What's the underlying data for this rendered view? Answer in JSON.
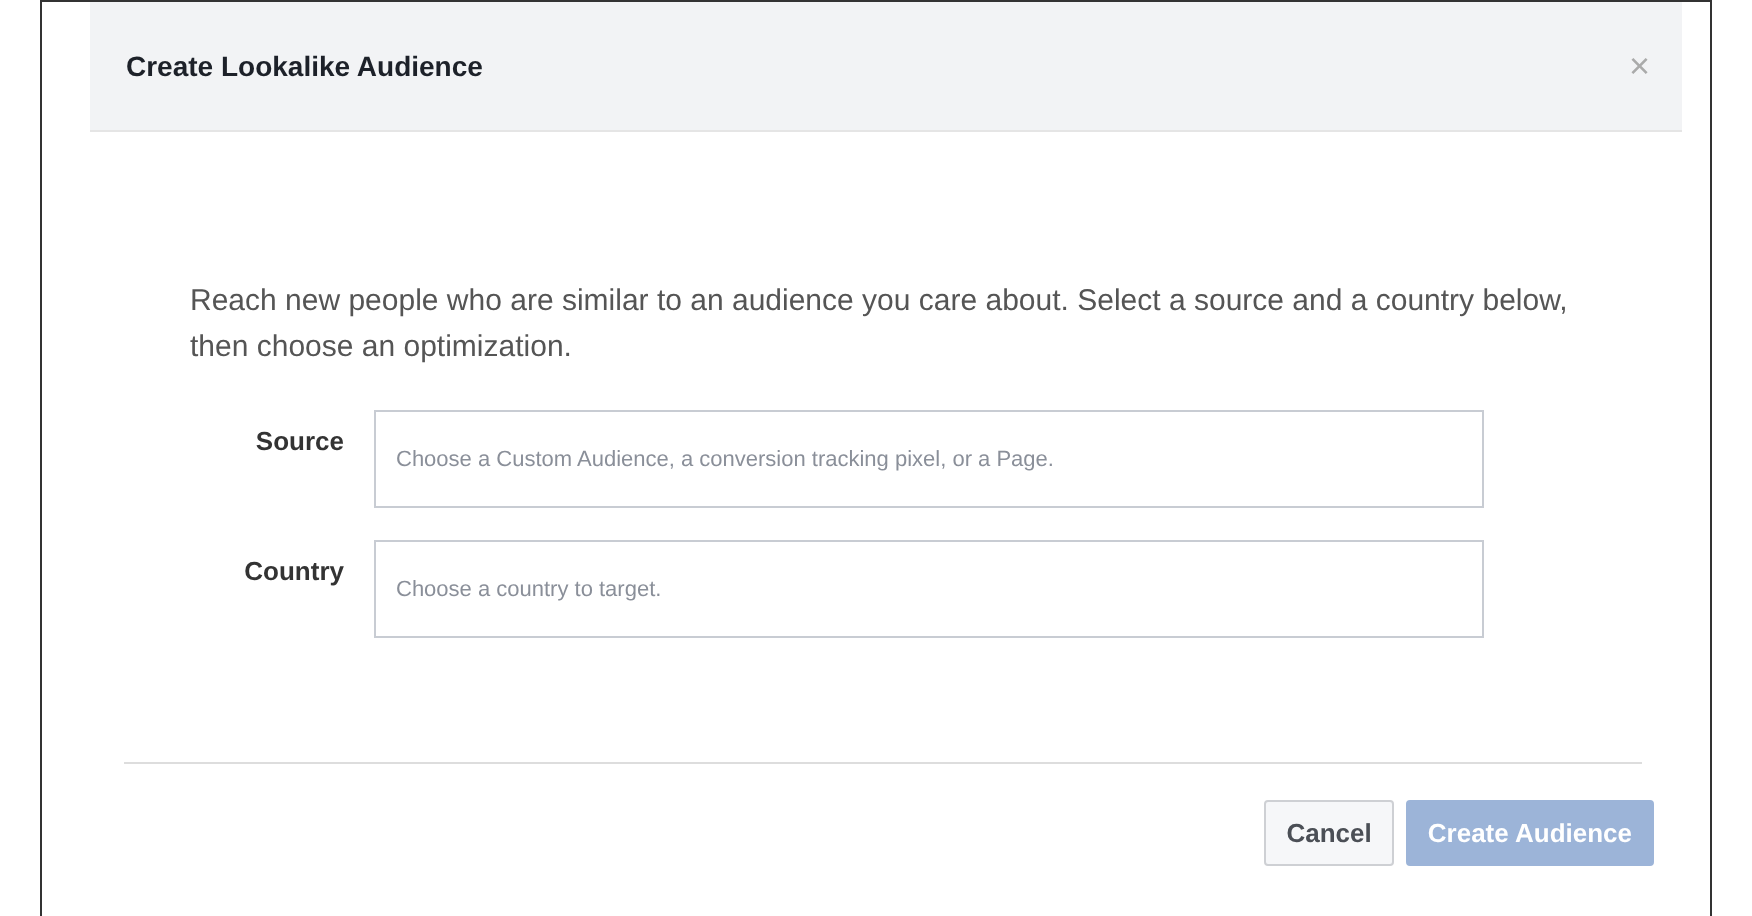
{
  "dialog": {
    "title": "Create Lookalike Audience",
    "close": "×"
  },
  "intro": "Reach new people who are similar to an audience you care about. Select a source and a country below, then choose an optimization.",
  "fields": [
    {
      "label": "Source",
      "placeholder": "Choose a Custom Audience, a conversion tracking pixel, or a Page."
    },
    {
      "label": "Country",
      "placeholder": "Choose a country to target."
    }
  ],
  "buttons": [
    {
      "label": "Cancel",
      "kind": "secondary",
      "disabled": false
    },
    {
      "label": "Create Audience",
      "kind": "primary",
      "disabled": true
    }
  ]
}
